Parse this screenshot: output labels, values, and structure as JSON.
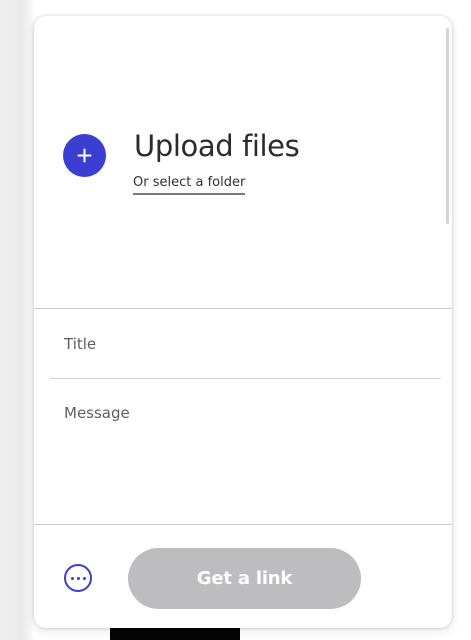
{
  "upload": {
    "title": "Upload files",
    "folder_link": "Or select a folder",
    "add_icon": "plus-icon"
  },
  "form": {
    "title_placeholder": "Title",
    "message_placeholder": "Message"
  },
  "footer": {
    "more_icon": "more-options-icon",
    "primary_label": "Get a link",
    "primary_disabled": true
  },
  "colors": {
    "accent": "#3b3fd1",
    "disabled_button": "#bdbdc0",
    "divider": "#cfcfcf"
  }
}
